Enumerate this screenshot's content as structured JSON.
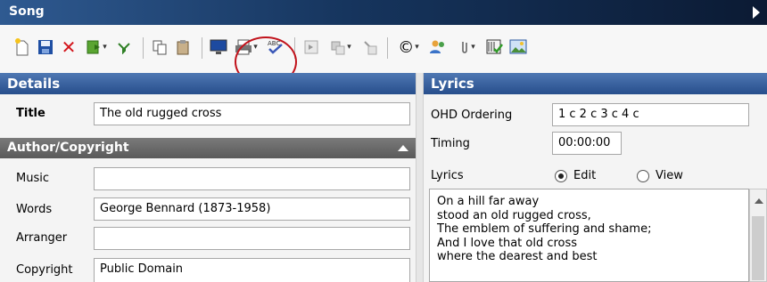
{
  "window": {
    "title": "Song"
  },
  "toolbar": {
    "icons": [
      "new-icon",
      "save-icon",
      "delete-icon",
      "export-icon",
      "filter-icon",
      "copy-icon",
      "paste-icon",
      "display-icon",
      "print-icon",
      "spellcheck-icon",
      "arrow-right-icon",
      "link-icon",
      "unlink-icon",
      "copyright-icon",
      "people-icon",
      "attachment-icon",
      "theme-icon",
      "image-icon"
    ],
    "copyright_glyph": "©"
  },
  "details": {
    "header": "Details",
    "title_label": "Title",
    "title_value": "The old rugged cross"
  },
  "author": {
    "header": "Author/Copyright",
    "music_label": "Music",
    "music_value": "",
    "words_label": "Words",
    "words_value": "George Bennard (1873-1958)",
    "arranger_label": "Arranger",
    "arranger_value": "",
    "copyright_label": "Copyright",
    "copyright_value": "Public Domain"
  },
  "lyrics": {
    "header": "Lyrics",
    "ohd_label": "OHD Ordering",
    "ohd_value": "1 c 2 c 3 c 4 c",
    "timing_label": "Timing",
    "timing_value": "00:00:00",
    "lyrics_label": "Lyrics",
    "mode_options": [
      "Edit",
      "View"
    ],
    "mode_selected": "Edit",
    "lines": [
      "On a hill far away",
      "stood an old rugged cross,",
      "The emblem of suffering and shame;",
      "And I love that old cross",
      "where the dearest and best"
    ]
  }
}
